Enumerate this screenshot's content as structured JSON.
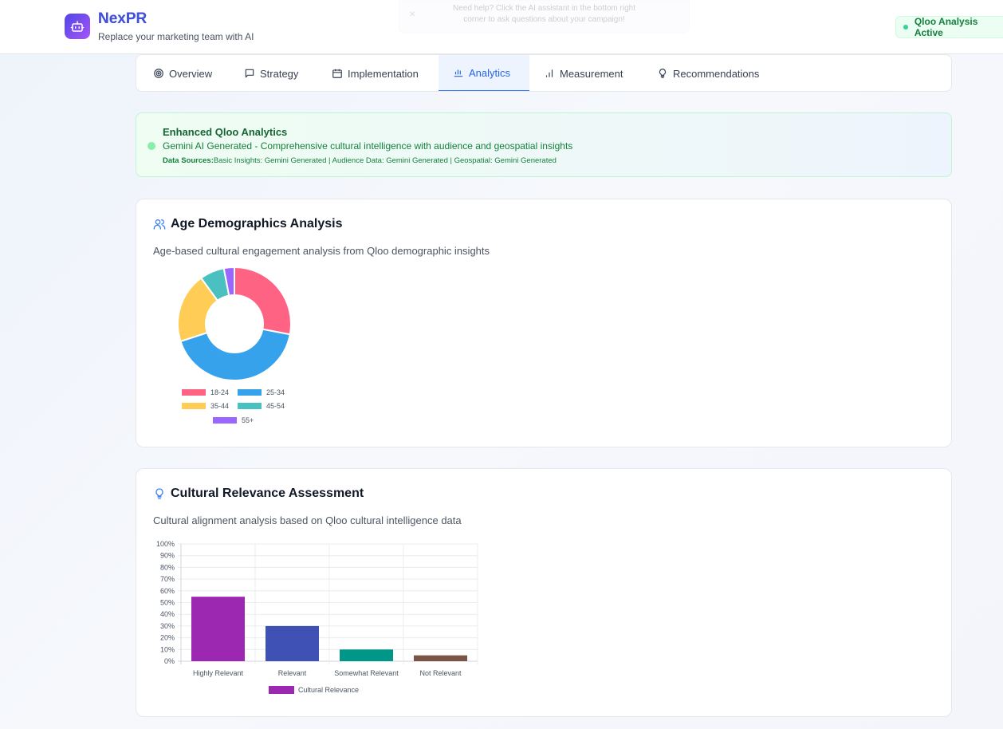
{
  "header": {
    "brand": "NexPR",
    "tagline": "Replace your marketing team with AI",
    "toast_line1": "Need help? Click the AI assistant in the bottom right",
    "toast_line2": "corner to ask questions about your campaign!",
    "status": "Qloo Analysis Active",
    "brand_color": "#4f46e5",
    "status_color": "#15803d"
  },
  "tabs": [
    {
      "label": "Overview",
      "icon": "target-icon"
    },
    {
      "label": "Strategy",
      "icon": "message-icon"
    },
    {
      "label": "Implementation",
      "icon": "calendar-icon"
    },
    {
      "label": "Analytics",
      "icon": "bar-chart-icon",
      "active": true
    },
    {
      "label": "Measurement",
      "icon": "signal-icon"
    },
    {
      "label": "Recommendations",
      "icon": "lightbulb-icon"
    }
  ],
  "banner": {
    "title": "Enhanced Qloo Analytics",
    "subtitle": "Gemini AI Generated - Comprehensive cultural intelligence with audience and geospatial insights",
    "sources_label": "Data Sources:",
    "sources_text": "Basic Insights: Gemini Generated | Audience Data: Gemini Generated | Geospatial: Gemini Generated"
  },
  "age_card": {
    "title": "Age Demographics Analysis",
    "subtitle": "Age-based cultural engagement analysis from Qloo demographic insights"
  },
  "relevance_card": {
    "title": "Cultural Relevance Assessment",
    "subtitle": "Cultural alignment analysis based on Qloo cultural intelligence data"
  },
  "chart_data": [
    {
      "type": "pie",
      "variant": "doughnut",
      "categories": [
        "18-24",
        "25-34",
        "35-44",
        "45-54",
        "55+"
      ],
      "values": [
        28,
        42,
        20,
        7,
        3
      ],
      "colors": [
        "#ff6384",
        "#36a2eb",
        "#ffcd56",
        "#4bc0c0",
        "#9966ff"
      ],
      "legend": "bottom"
    },
    {
      "type": "bar",
      "categories": [
        "Highly Relevant",
        "Relevant",
        "Somewhat Relevant",
        "Not Relevant"
      ],
      "series": [
        {
          "name": "Cultural Relevance",
          "values": [
            55,
            30,
            10,
            5
          ]
        }
      ],
      "colors": [
        "#9c27b0",
        "#3f51b5",
        "#009688",
        "#795548"
      ],
      "ylim": [
        0,
        100
      ],
      "yticks": [
        "0%",
        "10%",
        "20%",
        "30%",
        "40%",
        "50%",
        "60%",
        "70%",
        "80%",
        "90%",
        "100%"
      ],
      "grid": true,
      "legend": "bottom"
    }
  ]
}
